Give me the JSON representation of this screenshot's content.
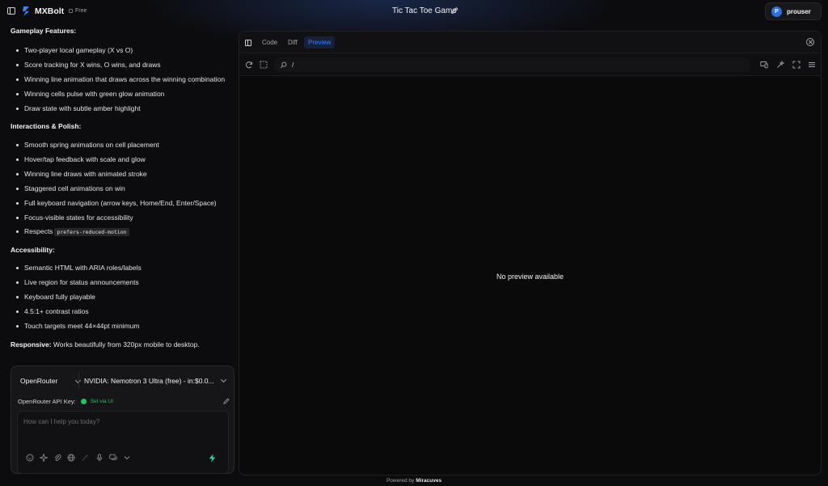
{
  "app": {
    "brand": "MXBolt",
    "plan": "Free",
    "project_title": "Tic Tac Toe Game"
  },
  "user": {
    "initial": "P",
    "name": "prouser",
    "avatar_color": "#2f6fd8"
  },
  "chat": {
    "gameplay_heading": "Gameplay Features:",
    "gameplay": [
      "Two-player local gameplay (X vs O)",
      "Score tracking for X wins, O wins, and draws",
      "Winning line animation that draws across the winning combination",
      "Winning cells pulse with green glow animation",
      "Draw state with subtle amber highlight"
    ],
    "interactions_heading": "Interactions & Polish:",
    "interactions": [
      "Smooth spring animations on cell placement",
      "Hover/tap feedback with scale and glow",
      "Winning line draws with animated stroke",
      "Staggered cell animations on win",
      "Full keyboard navigation (arrow keys, Home/End, Enter/Space)",
      "Focus-visible states for accessibility"
    ],
    "respects_prefix": "Respects",
    "respects_code": "prefers-reduced-motion",
    "accessibility_heading": "Accessibility:",
    "accessibility": [
      "Semantic HTML with ARIA roles/labels",
      "Live region for status announcements",
      "Keyboard fully playable",
      "4.5:1+ contrast ratios",
      "Touch targets meet 44×44pt minimum"
    ],
    "responsive_label": "Responsive:",
    "responsive_text": "Works beautifully from 320px mobile to desktop."
  },
  "composer": {
    "provider": "OpenRouter",
    "model": "NVIDIA: Nemotron 3 Ultra (free) - in:$0.0...",
    "api_key_label": "OpenRouter API Key:",
    "api_key_status": "Set via UI",
    "status_color": "#22c55e",
    "placeholder": "How can I help you today?",
    "tools": [
      "face-icon",
      "sparkle-icon",
      "paperclip-icon",
      "globe-icon",
      "wand-icon",
      "microphone-icon",
      "chat-icon",
      "chevron-down-icon"
    ]
  },
  "preview": {
    "tabs": [
      "Code",
      "Diff",
      "Preview"
    ],
    "active_tab": "Preview",
    "url": "/",
    "empty_message": "No preview available",
    "accent": "#3b82f6"
  },
  "footer": {
    "prefix": "Powered by",
    "brand": "Miracuves"
  }
}
